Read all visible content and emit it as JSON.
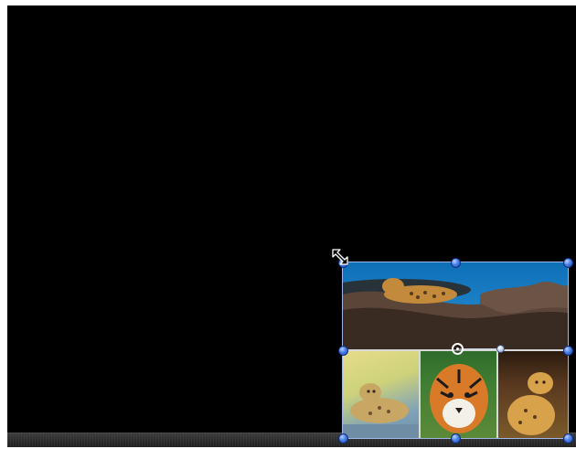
{
  "canvas": {
    "background": "#000000"
  },
  "selection": {
    "handle_color": "#3b6fe0",
    "outline_color": "#9fb6e6"
  },
  "images": [
    {
      "name": "leopard-on-branch",
      "icon": "photo-leopard-branch"
    },
    {
      "name": "leopard-lying",
      "icon": "photo-leopard-lying"
    },
    {
      "name": "tiger-face",
      "icon": "photo-tiger"
    },
    {
      "name": "cheetah-sitting",
      "icon": "photo-cheetah"
    }
  ],
  "cursor": {
    "icon": "resize-diagonal-cursor"
  }
}
